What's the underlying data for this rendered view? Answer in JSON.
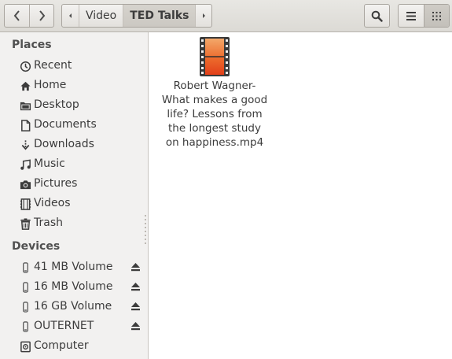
{
  "header": {
    "breadcrumbs": [
      "Video",
      "TED Talks"
    ]
  },
  "sidebar": {
    "places_title": "Places",
    "places": [
      {
        "label": "Recent",
        "icon": "recent-icon"
      },
      {
        "label": "Home",
        "icon": "home-icon"
      },
      {
        "label": "Desktop",
        "icon": "desktop-folder-icon"
      },
      {
        "label": "Documents",
        "icon": "documents-icon"
      },
      {
        "label": "Downloads",
        "icon": "downloads-icon"
      },
      {
        "label": "Music",
        "icon": "music-icon"
      },
      {
        "label": "Pictures",
        "icon": "pictures-icon"
      },
      {
        "label": "Videos",
        "icon": "videos-icon"
      },
      {
        "label": "Trash",
        "icon": "trash-icon"
      }
    ],
    "devices_title": "Devices",
    "devices": [
      {
        "label": "41 MB Volume",
        "icon": "drive-icon",
        "eject": true
      },
      {
        "label": "16 MB Volume",
        "icon": "drive-icon",
        "eject": true
      },
      {
        "label": "16 GB Volume",
        "icon": "drive-icon",
        "eject": true
      },
      {
        "label": "OUTERNET",
        "icon": "drive-icon",
        "eject": true
      },
      {
        "label": "Computer",
        "icon": "computer-icon",
        "eject": false
      }
    ]
  },
  "content": {
    "files": [
      {
        "name_lines": [
          "Robert Wagner-",
          "What makes a good",
          "life? Lessons from",
          "the longest study",
          "on happiness.mp4"
        ],
        "icon": "video-file-icon"
      }
    ]
  },
  "colors": {
    "sidebar_bg": "#f2f1f0",
    "header_bg": "#dcdad5",
    "video_icon_orange": "#e8541e"
  }
}
